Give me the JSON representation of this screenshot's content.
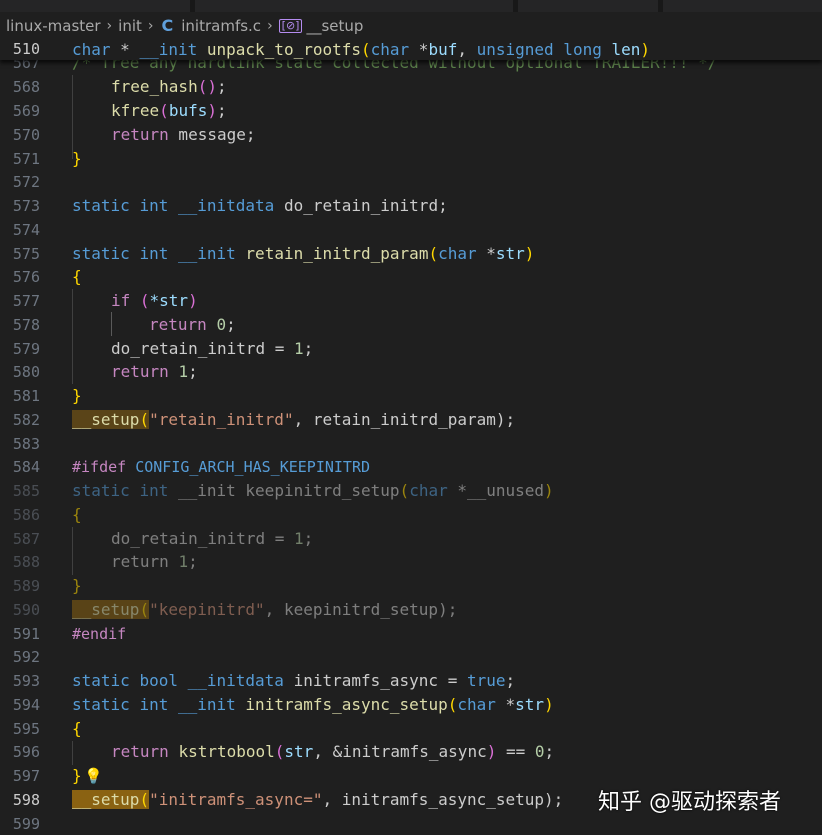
{
  "breadcrumb": {
    "folder1": "linux-master",
    "folder2": "init",
    "file": "initramfs.c",
    "symbol": "__setup"
  },
  "sticky": {
    "line_number": "510",
    "t1": "char",
    "t2": " * ",
    "t3": "__init",
    "t4": " ",
    "t5": "unpack_to_rootfs",
    "t6": "(",
    "t7": "char",
    "t8": " *",
    "t9": "buf",
    "t10": ", ",
    "t11": "unsigned long",
    "t12": " ",
    "t13": "len",
    "t14": ")",
    "ghost_line_number": "567",
    "ghost_text": "/* free any hardlink state collected without optional TRAILER!!! */"
  },
  "lines": {
    "l568": {
      "n": "568",
      "a": "free_hash",
      "b": "()",
      "c": ";"
    },
    "l569": {
      "n": "569",
      "a": "kfree",
      "b": "(",
      "c": "bufs",
      "d": ")",
      "e": ";"
    },
    "l570": {
      "n": "570",
      "a": "return",
      "b": " message;"
    },
    "l571": {
      "n": "571",
      "a": "}"
    },
    "l572": {
      "n": "572"
    },
    "l573": {
      "n": "573",
      "a": "static",
      "b": " ",
      "c": "int",
      "d": " ",
      "e": "__initdata",
      "f": " do_retain_initrd;"
    },
    "l574": {
      "n": "574"
    },
    "l575": {
      "n": "575",
      "a": "static",
      "b": " ",
      "c": "int",
      "d": " ",
      "e": "__init",
      "f": " ",
      "g": "retain_initrd_param",
      "h": "(",
      "i": "char",
      "j": " *",
      "k": "str",
      "l": ")"
    },
    "l576": {
      "n": "576",
      "a": "{"
    },
    "l577": {
      "n": "577",
      "a": "if",
      "b": " (",
      "c": "*str",
      "d": ")"
    },
    "l578": {
      "n": "578",
      "a": "return",
      "b": " ",
      "c": "0",
      "d": ";"
    },
    "l579": {
      "n": "579",
      "a": "do_retain_initrd = ",
      "b": "1",
      "c": ";"
    },
    "l580": {
      "n": "580",
      "a": "return",
      "b": " ",
      "c": "1",
      "d": ";"
    },
    "l581": {
      "n": "581",
      "a": "}"
    },
    "l582": {
      "n": "582",
      "a": "__setup",
      "b": "(",
      "c": "\"retain_initrd\"",
      "d": ", retain_initrd_param);"
    },
    "l583": {
      "n": "583"
    },
    "l584": {
      "n": "584",
      "a": "#ifdef",
      "b": " ",
      "c": "CONFIG_ARCH_HAS_KEEPINITRD"
    },
    "l585": {
      "n": "585",
      "a": "static",
      "b": " ",
      "c": "int",
      "d": " ",
      "e": "__init",
      "f": " keepinitrd_setup",
      "g": "(",
      "h": "char",
      "i": " *__unused",
      "j": ")"
    },
    "l586": {
      "n": "586",
      "a": "{"
    },
    "l587": {
      "n": "587",
      "a": "do_retain_initrd = ",
      "b": "1",
      "c": ";"
    },
    "l588": {
      "n": "588",
      "a": "return",
      "b": " ",
      "c": "1",
      "d": ";"
    },
    "l589": {
      "n": "589",
      "a": "}"
    },
    "l590": {
      "n": "590",
      "a": "__setup",
      "b": "(",
      "c": "\"keepinitrd\"",
      "d": ", keepinitrd_setup);"
    },
    "l591": {
      "n": "591",
      "a": "#endif"
    },
    "l592": {
      "n": "592"
    },
    "l593": {
      "n": "593",
      "a": "static",
      "b": " ",
      "c": "bool",
      "d": " ",
      "e": "__initdata",
      "f": " initramfs_async = ",
      "g": "true",
      "h": ";"
    },
    "l594": {
      "n": "594",
      "a": "static",
      "b": " ",
      "c": "int",
      "d": " ",
      "e": "__init",
      "f": " ",
      "g": "initramfs_async_setup",
      "h": "(",
      "i": "char",
      "j": " *",
      "k": "str",
      "l": ")"
    },
    "l595": {
      "n": "595",
      "a": "{"
    },
    "l596": {
      "n": "596",
      "a": "return",
      "b": " ",
      "c": "kstrtobool",
      "d": "(",
      "e": "str",
      "f": ", &initramfs_async",
      "g": ")",
      "h": " == ",
      "i": "0",
      "j": ";"
    },
    "l597": {
      "n": "597",
      "a": "}"
    },
    "l598": {
      "n": "598",
      "a": "__setup",
      "b": "(",
      "c": "\"initramfs_async=\"",
      "d": ", initramfs_async_setup);"
    },
    "l599": {
      "n": "599"
    }
  },
  "watermark": "知乎 @驱动探索者",
  "colors": {
    "background": "#1f1f1f",
    "keyword": "#569cd6",
    "function": "#dcdcaa",
    "string": "#ce9178",
    "number": "#b5cea8",
    "control": "#c586c0",
    "bracket_highlight": "#8a6212"
  }
}
